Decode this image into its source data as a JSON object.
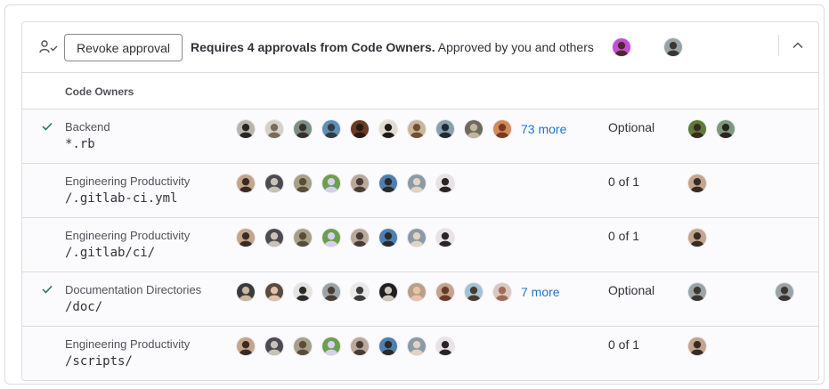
{
  "header": {
    "revoke_label": "Revoke approval",
    "requirement_bold": "Requires 4 approvals from Code Owners.",
    "requirement_rest": "Approved by you and others",
    "approver_avatars": [
      {
        "bg": "#c24fd6",
        "fg": "#4a2b2a"
      },
      {
        "bg": "#9aa3a8",
        "fg": "#3b3632"
      }
    ]
  },
  "table": {
    "column_header": "Code Owners",
    "rows": [
      {
        "approved": true,
        "name": "Backend",
        "path": "*.rb",
        "more": "73 more",
        "status": "Optional",
        "owners": [
          {
            "bg": "#b9b4ae",
            "fg": "#2b2522"
          },
          {
            "bg": "#d5d0c8",
            "fg": "#7a6b5c"
          },
          {
            "bg": "#7b8f86",
            "fg": "#3a2f28"
          },
          {
            "bg": "#5e8fb5",
            "fg": "#2f3c44"
          },
          {
            "bg": "#6b3a22",
            "fg": "#2a1a14"
          },
          {
            "bg": "#e2dccf",
            "fg": "#1e1a18"
          },
          {
            "bg": "#c9b79b",
            "fg": "#6f4f36"
          },
          {
            "bg": "#8aa0ad",
            "fg": "#1e2a38"
          },
          {
            "bg": "#6f6a5d",
            "fg": "#c2b5a0"
          },
          {
            "bg": "#d18a5b",
            "fg": "#7a3a22"
          }
        ],
        "approvers": [
          {
            "bg": "#5f7a3c",
            "fg": "#3a2a1c"
          },
          {
            "bg": "#7e9a7c",
            "fg": "#2a2420"
          }
        ],
        "extra_approver": null
      },
      {
        "approved": false,
        "name": "Engineering Productivity",
        "path": "/.gitlab-ci.yml",
        "more": "",
        "status": "0 of 1",
        "owners": [
          {
            "bg": "#c2a58b",
            "fg": "#3a2a24"
          },
          {
            "bg": "#4a4a52",
            "fg": "#c9c2b8"
          },
          {
            "bg": "#a7a089",
            "fg": "#5a4c3a"
          },
          {
            "bg": "#6aa04a",
            "fg": "#d6d0f0"
          },
          {
            "bg": "#b8a99a",
            "fg": "#4a3c32"
          },
          {
            "bg": "#4d7fb0",
            "fg": "#2a2a2a"
          },
          {
            "bg": "#8a9aa6",
            "fg": "#e2d3c4"
          },
          {
            "bg": "#e8e2e6",
            "fg": "#2a2424"
          }
        ],
        "approvers": [
          {
            "bg": "#c2a58b",
            "fg": "#3a2a24"
          }
        ],
        "extra_approver": null
      },
      {
        "approved": false,
        "name": "Engineering Productivity",
        "path": "/.gitlab/ci/",
        "more": "",
        "status": "0 of 1",
        "owners": [
          {
            "bg": "#c2a58b",
            "fg": "#3a2a24"
          },
          {
            "bg": "#4a4a52",
            "fg": "#c9c2b8"
          },
          {
            "bg": "#a7a089",
            "fg": "#5a4c3a"
          },
          {
            "bg": "#6aa04a",
            "fg": "#d6d0f0"
          },
          {
            "bg": "#b8a99a",
            "fg": "#4a3c32"
          },
          {
            "bg": "#4d7fb0",
            "fg": "#2a2a2a"
          },
          {
            "bg": "#8a9aa6",
            "fg": "#e2d3c4"
          },
          {
            "bg": "#e8e2e6",
            "fg": "#2a2424"
          }
        ],
        "approvers": [
          {
            "bg": "#c2a58b",
            "fg": "#3a2a24"
          }
        ],
        "extra_approver": null
      },
      {
        "approved": true,
        "name": "Documentation Directories",
        "path": "/doc/",
        "more": "7 more",
        "status": "Optional",
        "owners": [
          {
            "bg": "#3a3a3a",
            "fg": "#c9b7a0"
          },
          {
            "bg": "#5a4a40",
            "fg": "#e0c2a6"
          },
          {
            "bg": "#e6e3de",
            "fg": "#2a2a2a"
          },
          {
            "bg": "#9aa3a8",
            "fg": "#4a3d36"
          },
          {
            "bg": "#e9e9e9",
            "fg": "#3a3a3a"
          },
          {
            "bg": "#1f1f1f",
            "fg": "#cfc6bc"
          },
          {
            "bg": "#b6a08a",
            "fg": "#e8c4a6"
          },
          {
            "bg": "#c4a38f",
            "fg": "#6a3a28"
          },
          {
            "bg": "#9fc2d6",
            "fg": "#4a3a2c"
          },
          {
            "bg": "#d8c8c0",
            "fg": "#a06a58"
          }
        ],
        "approvers": [
          {
            "bg": "#9aa3a8",
            "fg": "#3b3632"
          }
        ],
        "extra_approver": {
          "bg": "#9aa3a8",
          "fg": "#3b3632"
        }
      },
      {
        "approved": false,
        "name": "Engineering Productivity",
        "path": "/scripts/",
        "more": "",
        "status": "0 of 1",
        "owners": [
          {
            "bg": "#c2a58b",
            "fg": "#3a2a24"
          },
          {
            "bg": "#4a4a52",
            "fg": "#c9c2b8"
          },
          {
            "bg": "#a7a089",
            "fg": "#5a4c3a"
          },
          {
            "bg": "#6aa04a",
            "fg": "#d6d0f0"
          },
          {
            "bg": "#b8a99a",
            "fg": "#4a3c32"
          },
          {
            "bg": "#4d7fb0",
            "fg": "#2a2a2a"
          },
          {
            "bg": "#8a9aa6",
            "fg": "#e2d3c4"
          },
          {
            "bg": "#e8e2e6",
            "fg": "#2a2424"
          }
        ],
        "approvers": [
          {
            "bg": "#c2a58b",
            "fg": "#3a2a24"
          }
        ],
        "extra_approver": null
      }
    ]
  }
}
